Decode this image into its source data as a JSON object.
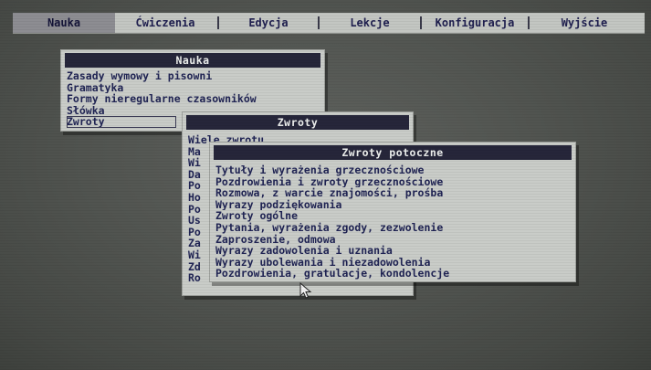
{
  "menubar": {
    "items": [
      {
        "label": "Nauka",
        "active": true
      },
      {
        "label": "Ćwiczenia",
        "active": false
      },
      {
        "label": "Edycja",
        "active": false
      },
      {
        "label": "Lekcje",
        "active": false
      },
      {
        "label": "Konfiguracja",
        "active": false
      },
      {
        "label": "Wyjście",
        "active": false
      }
    ]
  },
  "nauka_menu": {
    "title": "Nauka",
    "items": [
      "Zasady wymowy i pisowni",
      "Gramatyka",
      "Formy nieregularne czasowników",
      "Słówka",
      "Zwroty"
    ]
  },
  "zwroty_menu": {
    "title": "Zwroty",
    "items": [
      "Wiele zwrotu",
      "Ma",
      "Wi",
      "Da",
      "Po",
      "Ho",
      "Po",
      "Us",
      "Po",
      "Za",
      "Wi",
      "Zd",
      "Ro"
    ]
  },
  "zwroty_potoczne_menu": {
    "title": "Zwroty potoczne",
    "items": [
      "Tytuły i wyrażenia grzecznościowe",
      "Pozdrowienia i zwroty grzecznościowe",
      "Rozmowa, z warcie znajomości, prośba",
      "Wyrazy podziękowania",
      "Zwroty ogólne",
      "Pytania, wyrażenia zgody, zezwolenie",
      "Zaproszenie, odmowa",
      "Wyrazy zadowolenia i uznania",
      "Wyrazy ubolewania i niezadowolenia",
      "Pozdrowienia, gratulacje, kondolencje"
    ]
  },
  "colors": {
    "title_bar": "#26263a",
    "menu_bg": "#c9ccc8",
    "text": "#1f2353",
    "desktop": "#525551"
  }
}
